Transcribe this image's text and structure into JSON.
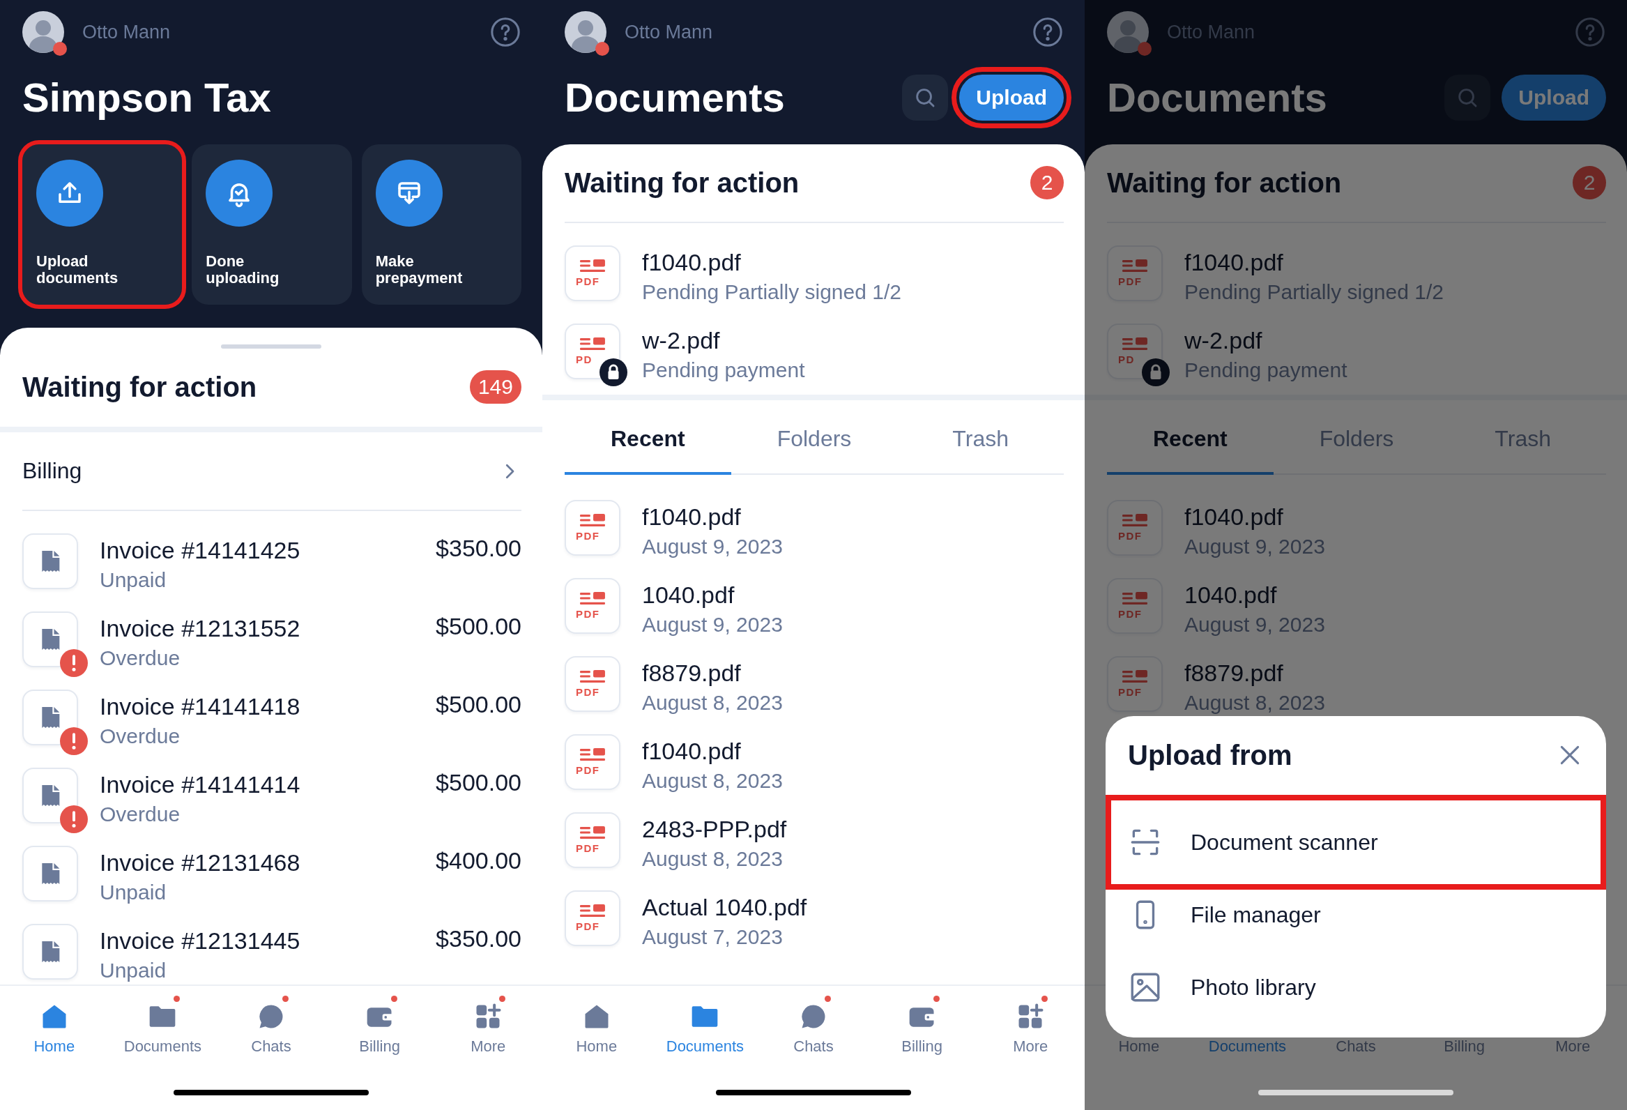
{
  "screens": [
    {
      "kind": "home",
      "user": {
        "name": "Otto Mann",
        "online": true
      },
      "title": "Simpson Tax",
      "actions": [
        {
          "label": "Upload documents",
          "highlighted": true
        },
        {
          "label": "Done uploading",
          "highlighted": false
        },
        {
          "label": "Make prepayment",
          "highlighted": false
        }
      ],
      "waiting": {
        "title": "Waiting for action",
        "count": "149"
      },
      "billing": {
        "title": "Billing"
      },
      "invoices": [
        {
          "title": "Invoice #14141425",
          "status": "Unpaid",
          "amount": "$350.00",
          "overdue": false
        },
        {
          "title": "Invoice #12131552",
          "status": "Overdue",
          "amount": "$500.00",
          "overdue": true
        },
        {
          "title": "Invoice #14141418",
          "status": "Overdue",
          "amount": "$500.00",
          "overdue": true
        },
        {
          "title": "Invoice #14141414",
          "status": "Overdue",
          "amount": "$500.00",
          "overdue": true
        },
        {
          "title": "Invoice #12131468",
          "status": "Unpaid",
          "amount": "$400.00",
          "overdue": false
        },
        {
          "title": "Invoice #12131445",
          "status": "Unpaid",
          "amount": "$350.00",
          "overdue": false
        }
      ],
      "nav": [
        {
          "label": "Home",
          "selected": true,
          "dot": false
        },
        {
          "label": "Documents",
          "selected": false,
          "dot": true
        },
        {
          "label": "Chats",
          "selected": false,
          "dot": true
        },
        {
          "label": "Billing",
          "selected": false,
          "dot": true
        },
        {
          "label": "More",
          "selected": false,
          "dot": true
        }
      ]
    },
    {
      "kind": "documents",
      "dimmed": false,
      "user": {
        "name": "Otto Mann",
        "online": true
      },
      "title": "Documents",
      "upload_button": {
        "label": "Upload",
        "highlighted": true
      },
      "waiting": {
        "title": "Waiting for action",
        "count": "2",
        "items": [
          {
            "name": "f1040.pdf",
            "status": "Pending Partially signed 1/2",
            "type_label": "PDF",
            "locked": false
          },
          {
            "name": "w-2.pdf",
            "status": "Pending payment",
            "type_label": "PD",
            "locked": true
          }
        ]
      },
      "tabs": [
        {
          "label": "Recent",
          "selected": true
        },
        {
          "label": "Folders",
          "selected": false
        },
        {
          "label": "Trash",
          "selected": false
        }
      ],
      "files": [
        {
          "name": "f1040.pdf",
          "date": "August 9, 2023",
          "type_label": "PDF"
        },
        {
          "name": "1040.pdf",
          "date": "August 9, 2023",
          "type_label": "PDF"
        },
        {
          "name": "f8879.pdf",
          "date": "August 8, 2023",
          "type_label": "PDF"
        },
        {
          "name": "f1040.pdf",
          "date": "August 8, 2023",
          "type_label": "PDF"
        },
        {
          "name": "2483-PPP.pdf",
          "date": "August 8, 2023",
          "type_label": "PDF"
        },
        {
          "name": "Actual 1040.pdf",
          "date": "August 7, 2023",
          "type_label": "PDF"
        }
      ],
      "nav": [
        {
          "label": "Home",
          "selected": false,
          "dot": false
        },
        {
          "label": "Documents",
          "selected": true,
          "dot": false
        },
        {
          "label": "Chats",
          "selected": false,
          "dot": true
        },
        {
          "label": "Billing",
          "selected": false,
          "dot": true
        },
        {
          "label": "More",
          "selected": false,
          "dot": true
        }
      ]
    },
    {
      "kind": "documents",
      "dimmed": true,
      "user": {
        "name": "Otto Mann",
        "online": true
      },
      "title": "Documents",
      "upload_button": {
        "label": "Upload",
        "highlighted": false
      },
      "waiting": {
        "title": "Waiting for action",
        "count": "2",
        "items": [
          {
            "name": "f1040.pdf",
            "status": "Pending Partially signed 1/2",
            "type_label": "PDF",
            "locked": false
          },
          {
            "name": "w-2.pdf",
            "status": "Pending payment",
            "type_label": "PD",
            "locked": true
          }
        ]
      },
      "tabs": [
        {
          "label": "Recent",
          "selected": true
        },
        {
          "label": "Folders",
          "selected": false
        },
        {
          "label": "Trash",
          "selected": false
        }
      ],
      "files": [
        {
          "name": "f1040.pdf",
          "date": "August 9, 2023",
          "type_label": "PDF"
        },
        {
          "name": "1040.pdf",
          "date": "August 9, 2023",
          "type_label": "PDF"
        },
        {
          "name": "f8879.pdf",
          "date": "August 8, 2023",
          "type_label": "PDF"
        }
      ],
      "nav": [
        {
          "label": "Home",
          "selected": false
        },
        {
          "label": "Documents",
          "selected": true
        },
        {
          "label": "Chats",
          "selected": false
        },
        {
          "label": "Billing",
          "selected": false
        },
        {
          "label": "More",
          "selected": false
        }
      ],
      "sheet": {
        "title": "Upload from",
        "options": [
          {
            "label": "Document scanner",
            "highlighted": true
          },
          {
            "label": "File manager",
            "highlighted": false
          },
          {
            "label": "Photo library",
            "highlighted": false
          }
        ]
      }
    }
  ]
}
